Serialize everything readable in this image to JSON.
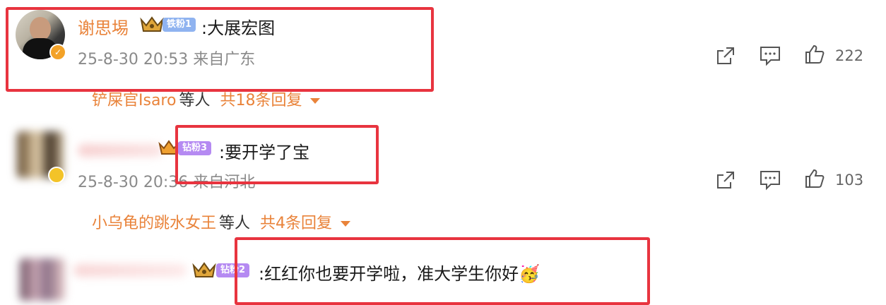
{
  "comments": [
    {
      "username": "谢思埸",
      "badge": "铁粉1",
      "text": ":大展宏图",
      "timestamp": "25-8-30 20:53 来自广东",
      "likes": "222",
      "replies": {
        "users": "铲屎官Isaro",
        "etc": "等人",
        "total": "共18条回复"
      }
    },
    {
      "badge": "钻粉3",
      "text": ":要开学了宝",
      "timestamp": "25-8-30 20:36 来自河北",
      "likes": "103",
      "replies": {
        "users": "小乌龟的跳水女王",
        "etc": "等人",
        "total": "共4条回复"
      }
    },
    {
      "badge": "钻粉2",
      "text": ":红红你也要开学啦，准大学生你好",
      "emoji": "🥳"
    }
  ],
  "colors": {
    "highlight_box": "#e8343f",
    "username": "#e9833a",
    "badge_iron": "#8fb3f0",
    "badge_diamond": "#b58af2"
  },
  "icons": [
    "share-icon",
    "comment-icon",
    "like-icon",
    "crown-icon",
    "verified-icon",
    "dropdown-caret-icon"
  ]
}
